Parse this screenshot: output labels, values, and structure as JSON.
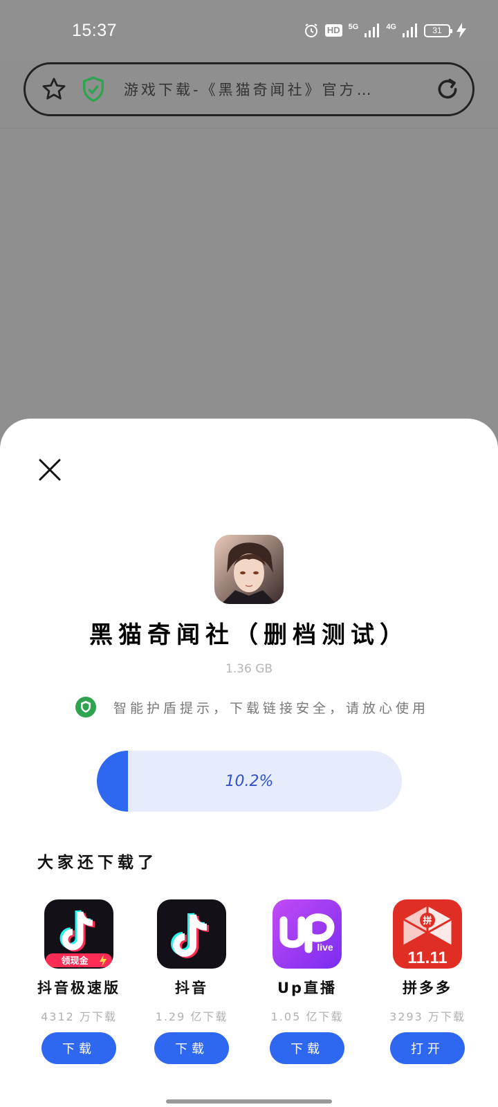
{
  "status_bar": {
    "time": "15:37",
    "hd_badge": "HD",
    "network_1": "5G",
    "network_2": "4G",
    "battery": "31"
  },
  "browser": {
    "page_title": "游戏下载-《黑猫奇闻社》官方…"
  },
  "sheet": {
    "app_title": "黑猫奇闻社（删档测试）",
    "app_size": "1.36 GB",
    "safety_note": "智能护盾提示，下载链接安全，请放心使用",
    "progress_label": "10.2%",
    "progress_fraction": 0.102,
    "section_title": "大家还下载了",
    "recommendations": [
      {
        "name": "抖音极速版",
        "count": "4312 万下载",
        "button": "下载",
        "icon": "douyin-lite-icon",
        "badge": "领现金"
      },
      {
        "name": "抖音",
        "count": "1.29 亿下载",
        "button": "下载",
        "icon": "douyin-icon"
      },
      {
        "name": "Up直播",
        "count": "1.05 亿下载",
        "button": "下载",
        "icon": "up-live-icon",
        "badge": "live"
      },
      {
        "name": "拼多多",
        "count": "3293 万下载",
        "button": "打开",
        "icon": "pinduoduo-icon",
        "badge": "11.11",
        "badge2": "拼"
      }
    ]
  },
  "colors": {
    "accent": "#2f68f0",
    "progress_track": "#e6ecfb",
    "overlay": "#8f8f8f",
    "shield_green": "#2ea44f"
  }
}
